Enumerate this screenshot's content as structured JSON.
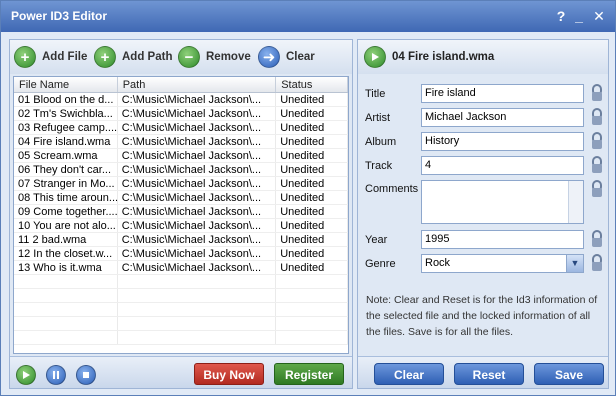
{
  "window": {
    "title": "Power ID3 Editor",
    "help": "?",
    "minimize": "_",
    "close": "✕"
  },
  "toolbar": {
    "add_file": "Add File",
    "add_path": "Add Path",
    "remove": "Remove",
    "clear": "Clear"
  },
  "table": {
    "columns": [
      "File Name",
      "Path",
      "Status"
    ],
    "rows": [
      [
        "01 Blood on the d...",
        "C:\\Music\\Michael Jackson\\...",
        "Unedited"
      ],
      [
        "02 Tm's Swichbla...",
        "C:\\Music\\Michael Jackson\\...",
        "Unedited"
      ],
      [
        "03 Refugee camp....",
        "C:\\Music\\Michael Jackson\\...",
        "Unedited"
      ],
      [
        "04 Fire island.wma",
        "C:\\Music\\Michael Jackson\\...",
        "Unedited"
      ],
      [
        "05 Scream.wma",
        "C:\\Music\\Michael Jackson\\...",
        "Unedited"
      ],
      [
        "06 They don't car...",
        "C:\\Music\\Michael Jackson\\...",
        "Unedited"
      ],
      [
        "07 Stranger in Mo...",
        "C:\\Music\\Michael Jackson\\...",
        "Unedited"
      ],
      [
        "08 This time aroun...",
        "C:\\Music\\Michael Jackson\\...",
        "Unedited"
      ],
      [
        "09 Come together....",
        "C:\\Music\\Michael Jackson\\...",
        "Unedited"
      ],
      [
        "10 You are not alo...",
        "C:\\Music\\Michael Jackson\\...",
        "Unedited"
      ],
      [
        "11 2 bad.wma",
        "C:\\Music\\Michael Jackson\\...",
        "Unedited"
      ],
      [
        "12 In the closet.w...",
        "C:\\Music\\Michael Jackson\\...",
        "Unedited"
      ],
      [
        "13 Who is it.wma",
        "C:\\Music\\Michael Jackson\\...",
        "Unedited"
      ]
    ]
  },
  "player": {
    "play_icon": "play-icon",
    "pause_icon": "pause-icon",
    "stop_icon": "stop-icon"
  },
  "buttons": {
    "buy_now": "Buy Now",
    "register": "Register"
  },
  "editor": {
    "title": "04 Fire island.wma",
    "fields": {
      "title_label": "Title",
      "title_value": "Fire island",
      "artist_label": "Artist",
      "artist_value": "Michael Jackson",
      "album_label": "Album",
      "album_value": "History",
      "track_label": "Track",
      "track_value": "4",
      "comments_label": "Comments",
      "comments_value": "",
      "year_label": "Year",
      "year_value": "1995",
      "genre_label": "Genre",
      "genre_value": "Rock"
    },
    "note": "Note:  Clear and Reset is for the Id3 information of the selected file and the locked information of all the files.  Save is for all the files.",
    "clear": "Clear",
    "reset": "Reset",
    "save": "Save"
  },
  "colors": {
    "accent": "#3f68b4",
    "buy_now": "#c9352a",
    "register": "#3f8b2e"
  }
}
